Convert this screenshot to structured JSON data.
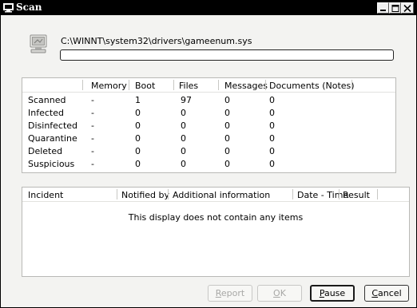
{
  "window": {
    "title": "Scan"
  },
  "scan": {
    "current_file": "C:\\WINNT\\system32\\drivers\\gameenum.sys",
    "progress": 0
  },
  "stats": {
    "columns": [
      "",
      "Memory",
      "Boot",
      "Files",
      "Messages",
      "Documents (Notes)"
    ],
    "rows": [
      {
        "label": "Scanned",
        "memory": "-",
        "boot": "1",
        "files": "97",
        "messages": "0",
        "documents": "0"
      },
      {
        "label": "Infected",
        "memory": "-",
        "boot": "0",
        "files": "0",
        "messages": "0",
        "documents": "0"
      },
      {
        "label": "Disinfected",
        "memory": "-",
        "boot": "0",
        "files": "0",
        "messages": "0",
        "documents": "0"
      },
      {
        "label": "Quarantine",
        "memory": "-",
        "boot": "0",
        "files": "0",
        "messages": "0",
        "documents": "0"
      },
      {
        "label": "Deleted",
        "memory": "-",
        "boot": "0",
        "files": "0",
        "messages": "0",
        "documents": "0"
      },
      {
        "label": "Suspicious",
        "memory": "-",
        "boot": "0",
        "files": "0",
        "messages": "0",
        "documents": "0"
      }
    ]
  },
  "incidents": {
    "columns": [
      "Incident",
      "Notified by",
      "Additional information",
      "Date - Time",
      "Result"
    ],
    "empty_message": "This display does not contain any items"
  },
  "buttons": {
    "report": {
      "first": "R",
      "rest": "eport",
      "enabled": false
    },
    "ok": {
      "first": "O",
      "rest": "K",
      "enabled": false
    },
    "pause": {
      "first": "P",
      "rest": "ause",
      "enabled": true
    },
    "cancel": {
      "first": "C",
      "rest": "ancel",
      "enabled": true
    }
  }
}
